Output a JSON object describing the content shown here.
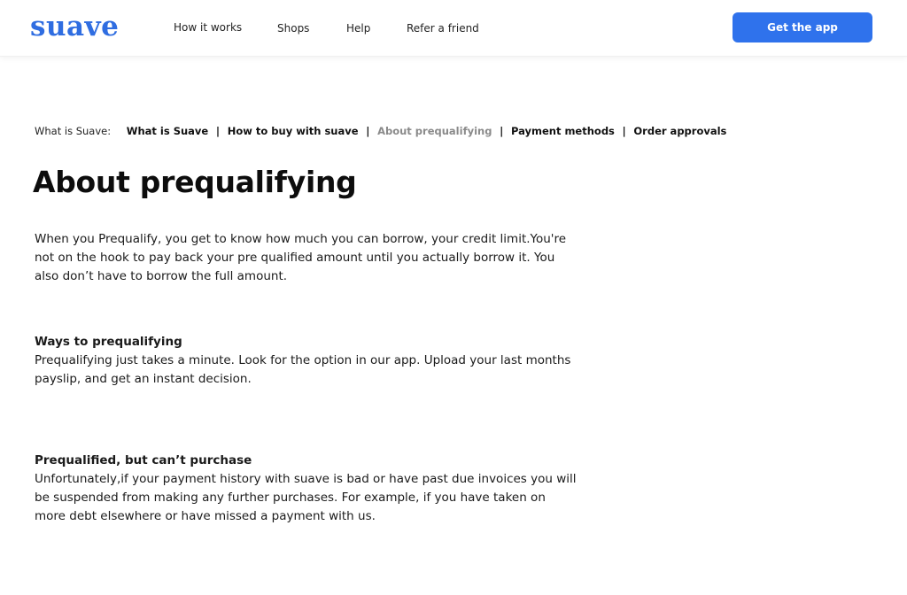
{
  "header": {
    "logo": "suave",
    "nav": [
      "How it works",
      "Shops",
      "Help",
      "Refer a friend"
    ],
    "cta_label": "Get the app"
  },
  "breadcrumb": {
    "prefix": "What is Suave:",
    "items": [
      "What is Suave",
      "How to buy with suave",
      "About prequalifying",
      "Payment methods",
      "Order approvals"
    ],
    "separator": "|",
    "active_index": 2
  },
  "main": {
    "title": "About prequalifying",
    "intro": "When you Prequalify, you get to know how much you can borrow, your credit limit.You're not on the hook to pay back your pre qualified amount until you actually borrow it. You also don’t have to borrow the full amount.",
    "sections": [
      {
        "heading": "Ways to prequalifying",
        "body": "Prequalifying just takes a minute. Look for the option in our app. Upload your last months payslip, and get an instant decision."
      },
      {
        "heading": "Prequalified, but can’t purchase",
        "body": "Unfortunately,if your payment history with suave is bad or have past due invoices  you will be suspended from making any further purchases. For example, if you have taken on more debt elsewhere or have missed a payment with us."
      }
    ]
  },
  "colors": {
    "brand": "#2f6de1",
    "cta": "#2f72ec",
    "active_crumb": "#8a8a8a"
  }
}
